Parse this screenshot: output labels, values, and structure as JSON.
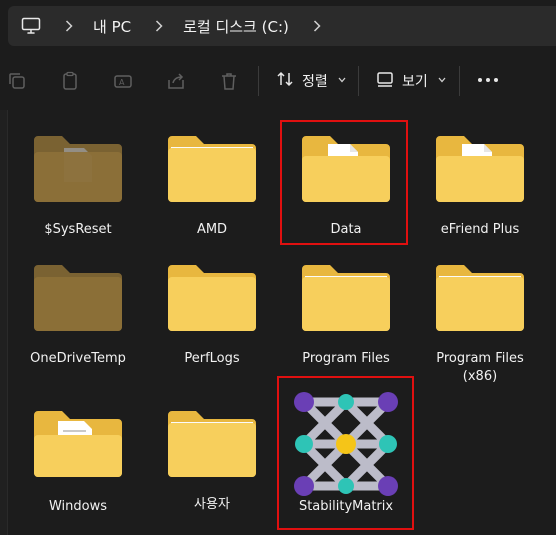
{
  "address_bar": {
    "segments": [
      "내 PC",
      "로컬 디스크 (C:)"
    ]
  },
  "toolbar": {
    "sort_label": "정렬",
    "view_label": "보기"
  },
  "items": [
    {
      "name": "$SysReset",
      "type": "folder-hidden-doc"
    },
    {
      "name": "AMD",
      "type": "folder"
    },
    {
      "name": "Data",
      "type": "folder-doc",
      "highlighted": true
    },
    {
      "name": "eFriend Plus",
      "type": "folder-doc"
    },
    {
      "name": "OneDriveTemp",
      "type": "folder-hidden"
    },
    {
      "name": "PerfLogs",
      "type": "folder"
    },
    {
      "name": "Program Files",
      "type": "folder"
    },
    {
      "name": "Program Files\n(x86)",
      "line1": "Program Files",
      "line2": "(x86)",
      "type": "folder"
    },
    {
      "name": "Windows",
      "type": "folder-doc-lines"
    },
    {
      "name": "사용자",
      "type": "folder"
    },
    {
      "name": "StabilityMatrix",
      "type": "app-icon",
      "highlighted": true
    }
  ],
  "colors": {
    "background": "#1c1c1c",
    "address_bar": "#2b2b2b",
    "folder_front": "#f7cf5c",
    "folder_back": "#e8b73f",
    "highlight": "#e01010",
    "stability_purple": "#6a3fb5",
    "stability_teal": "#2ec4b6",
    "stability_yellow": "#f5c518"
  }
}
